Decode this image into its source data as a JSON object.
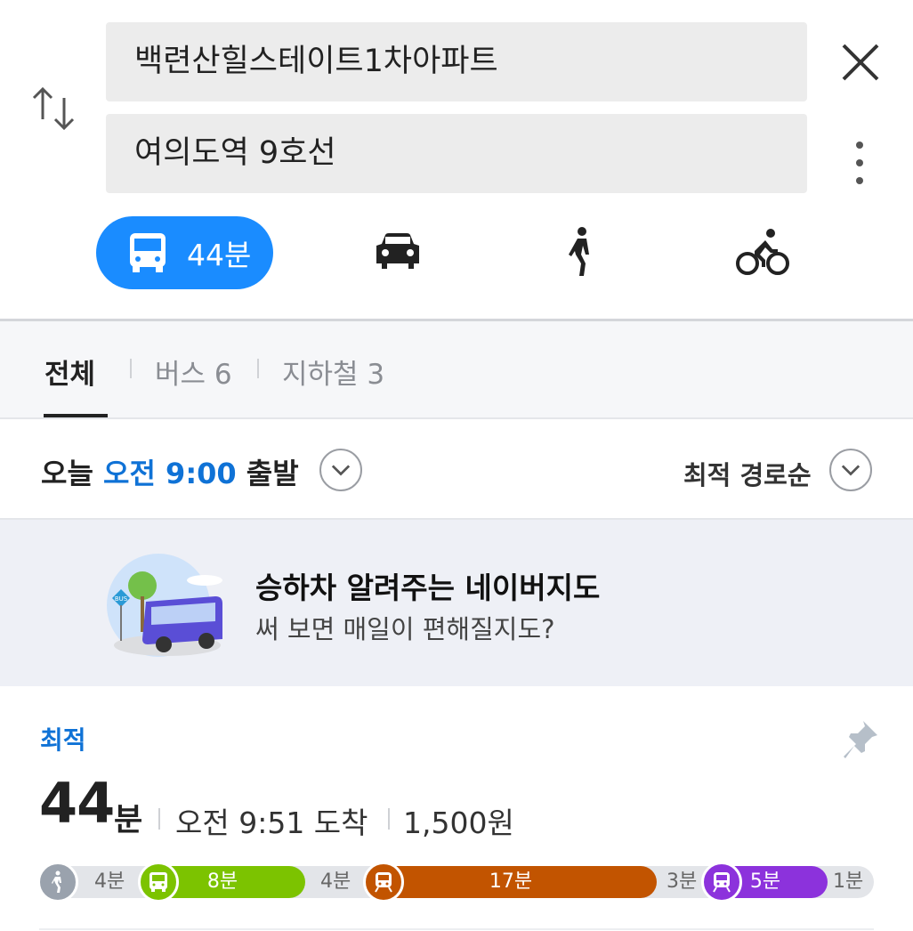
{
  "search": {
    "origin": "백련산힐스테이트1차아파트",
    "destination": "여의도역 9호선"
  },
  "modes": {
    "transit_label": "44분"
  },
  "tabs": [
    {
      "label": "전체"
    },
    {
      "label": "버스 6"
    },
    {
      "label": "지하철 3"
    }
  ],
  "departure": {
    "prefix": "오늘",
    "time": "오전 9:00",
    "suffix": "출발"
  },
  "sort": {
    "label": "최적 경로순"
  },
  "banner": {
    "title": "승하차 알려주는 네이버지도",
    "subtitle": "써 보면 매일이 편해질지도?",
    "bus_sign": "BUS"
  },
  "result": {
    "tag": "최적",
    "duration_num": "44",
    "duration_unit": "분",
    "arrival": "오전 9:51 도착",
    "fare": "1,500원",
    "segments": {
      "walk1": "4분",
      "bus": "8분",
      "walk2": "4분",
      "subway1": "17분",
      "walk3": "3분",
      "subway2": "5분",
      "walk4": "1분"
    }
  },
  "colors": {
    "accent": "#1a8cff",
    "bus_green": "#7cc300",
    "subway_brown": "#c25400",
    "subway_purple": "#8c32dc"
  },
  "icons": {
    "swap": "swap-icon",
    "close": "close-icon",
    "more": "more-vertical-icon",
    "bus": "bus-icon",
    "car": "car-icon",
    "walk": "walk-icon",
    "bike": "bike-icon",
    "pin": "pin-icon"
  }
}
